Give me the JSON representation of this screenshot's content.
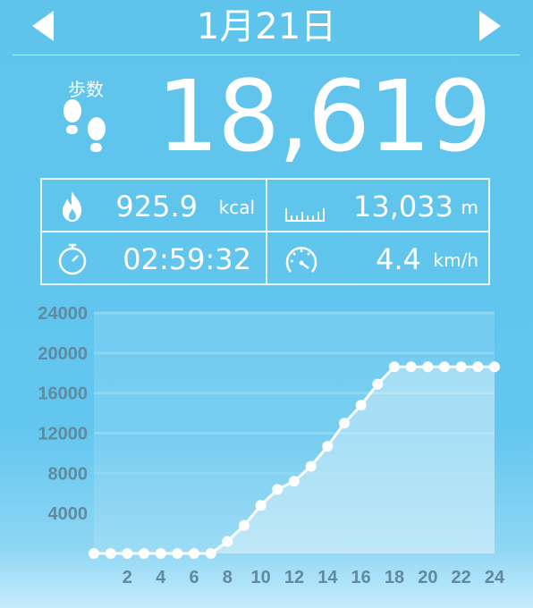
{
  "header": {
    "date": "1月21日",
    "prev_icon": "triangle-left-icon",
    "next_icon": "triangle-right-icon"
  },
  "steps": {
    "label": "歩数",
    "value": "18,619",
    "icon": "footprints-icon"
  },
  "stats": {
    "calories": {
      "value": "925.9",
      "unit": "kcal",
      "icon": "flame-icon"
    },
    "distance": {
      "value": "13,033",
      "unit": "m",
      "icon": "ruler-icon"
    },
    "duration": {
      "value": "02:59:32",
      "unit": "",
      "icon": "stopwatch-icon"
    },
    "speed": {
      "value": "4.4",
      "unit": "km/h",
      "icon": "speedometer-icon"
    }
  },
  "colors": {
    "background": "#62c6ee",
    "text": "#ffffff",
    "axis_label": "#5f8a9f",
    "grid": "#8fd6f3"
  },
  "chart_data": {
    "type": "line",
    "title": "",
    "xlabel": "",
    "ylabel": "",
    "xlim": [
      0,
      24
    ],
    "ylim": [
      0,
      24000
    ],
    "x_ticks": [
      2,
      4,
      6,
      8,
      10,
      12,
      14,
      16,
      18,
      20,
      22,
      24
    ],
    "y_ticks": [
      4000,
      8000,
      12000,
      16000,
      20000,
      24000
    ],
    "grid": true,
    "series": [
      {
        "x": [
          0,
          1,
          2,
          3,
          4,
          5,
          6,
          7,
          8,
          9,
          10,
          11,
          12,
          13,
          14,
          15,
          16,
          17,
          18,
          19,
          20,
          21,
          22,
          23,
          24
        ],
        "values": [
          0,
          0,
          0,
          0,
          0,
          0,
          0,
          0,
          1200,
          2800,
          4800,
          6400,
          7200,
          8700,
          10700,
          13000,
          14800,
          16900,
          18619,
          18619,
          18619,
          18619,
          18619,
          18619,
          18619
        ]
      }
    ]
  }
}
